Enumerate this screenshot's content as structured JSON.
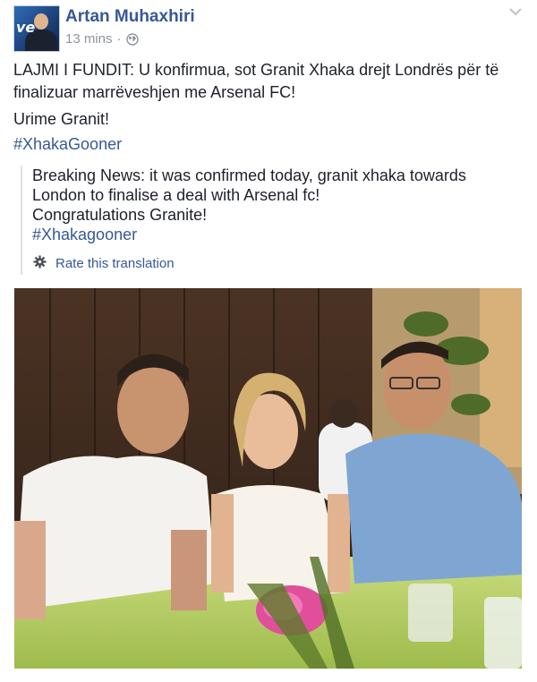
{
  "post": {
    "author": "Artan Muhaxhiri",
    "time": "13 mins",
    "separator": "·",
    "text_p1": "LAJMI I FUNDIT: U konfirmua, sot Granit Xhaka drejt Londrës për të finalizuar marrëveshjen me Arsenal FC!",
    "text_p2": "Urime Granit!",
    "hashtag": "#XhakaGooner",
    "avatar_text": "ve",
    "translation": {
      "line1": "Breaking News: it was confirmed today, granit xhaka towards London to finalise a deal with Arsenal fc!",
      "line2": "Congratulations Granite!",
      "hashtag": "#Xhakagooner",
      "rate_label": "Rate this translation"
    }
  },
  "colors": {
    "link": "#365899",
    "meta": "#90949c",
    "text": "#1d2129"
  },
  "icons": {
    "privacy": "globe-icon",
    "menu": "chevron-down-icon",
    "rate": "gear-icon"
  }
}
